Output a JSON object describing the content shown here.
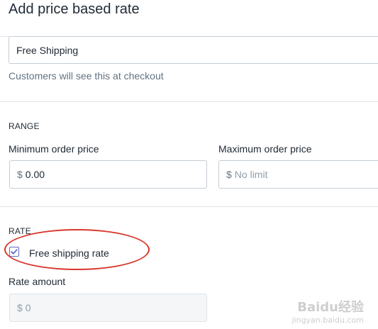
{
  "title": "Add price based rate",
  "rate_name": {
    "value": "Free Shipping",
    "help": "Customers will see this at checkout"
  },
  "range": {
    "heading": "RANGE",
    "min_label": "Minimum order price",
    "min_prefix": "$",
    "min_value": "0.00",
    "max_label": "Maximum order price",
    "max_prefix": "$",
    "max_placeholder": "No limit"
  },
  "rate": {
    "heading": "RATE",
    "free_shipping_label": "Free shipping rate",
    "free_shipping_checked": true,
    "amount_label": "Rate amount",
    "amount_prefix": "$",
    "amount_value": "0"
  },
  "watermark": {
    "brand": "Baidu经验",
    "url": "jingyan.baidu.com"
  },
  "colors": {
    "accent": "#5c6ac4",
    "annotation": "#d9362b"
  }
}
